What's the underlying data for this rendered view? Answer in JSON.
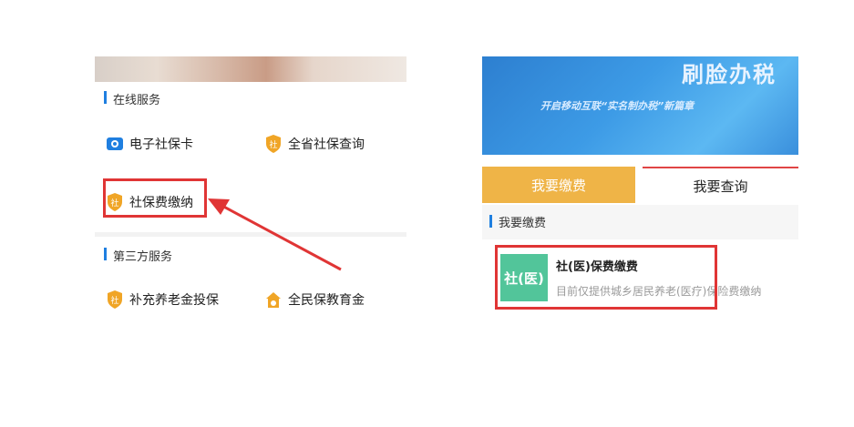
{
  "left": {
    "online_section": "在线服务",
    "items": [
      {
        "label": "电子社保卡",
        "icon": "card-icon"
      },
      {
        "label": "全省社保查询",
        "icon": "shield-badge-icon"
      },
      {
        "label": "社保费缴纳",
        "icon": "shield-badge-icon"
      }
    ],
    "third_party_section": "第三方服务",
    "third_items": [
      {
        "label": "补充养老金投保",
        "icon": "shield-badge-icon"
      },
      {
        "label": "全民保教育金",
        "icon": "house-coin-icon"
      }
    ],
    "badge_char": "社"
  },
  "right": {
    "banner_title": "刷脸办税",
    "banner_subtitle": "开启移动互联“实名制办税”新篇章",
    "tabs": [
      "我要缴费",
      "我要查询"
    ],
    "section_title": "我要缴费",
    "service": {
      "logo_text": "社(医)",
      "title": "社(医)保费缴费",
      "description": "目前仅提供城乡居民养老(医疗)保险费缴纳"
    }
  },
  "colors": {
    "accent_blue": "#1f7fe0",
    "shield_orange": "#f0a526",
    "tab_active": "#efb447",
    "highlight_red": "#e03535",
    "service_green": "#52c59a"
  }
}
